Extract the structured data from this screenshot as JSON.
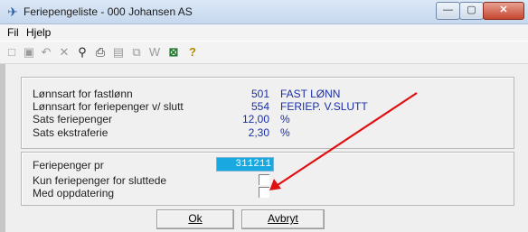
{
  "window": {
    "title": "Feriepengeliste - 000 Johansen AS",
    "min_label": "—",
    "max_label": "▢",
    "close_label": "✕"
  },
  "menu": [
    "Fil",
    "Hjelp"
  ],
  "toolbar": {
    "icons": [
      "new-icon",
      "save-icon",
      "undo-icon",
      "delete-icon",
      "find-icon",
      "print-icon",
      "preview-icon",
      "copy-icon",
      "word-icon",
      "excel-icon",
      "help-icon"
    ]
  },
  "settings": {
    "rows": [
      {
        "label": "Lønnsart for fastlønn",
        "value": "501",
        "text": "FAST LØNN"
      },
      {
        "label": "Lønnsart for feriepenger v/ slutt",
        "value": "554",
        "text": "FERIEP. V.SLUTT"
      },
      {
        "label": "Sats feriepenger",
        "value": "12,00",
        "text": "%"
      },
      {
        "label": "Sats ekstraferie",
        "value": "2,30",
        "text": "%"
      }
    ]
  },
  "options": {
    "date_label": "Feriepenger pr",
    "date_value": "311211",
    "only_terminated_label": "Kun feriepenger for sluttede",
    "only_terminated_checked": false,
    "with_update_label": "Med oppdatering",
    "with_update_checked": false
  },
  "buttons": {
    "ok": "Ok",
    "cancel": "Avbryt"
  },
  "colors": {
    "annotation_arrow": "#e01010",
    "value_text": "#1b2fa5",
    "date_highlight": "#1aa8e0"
  }
}
